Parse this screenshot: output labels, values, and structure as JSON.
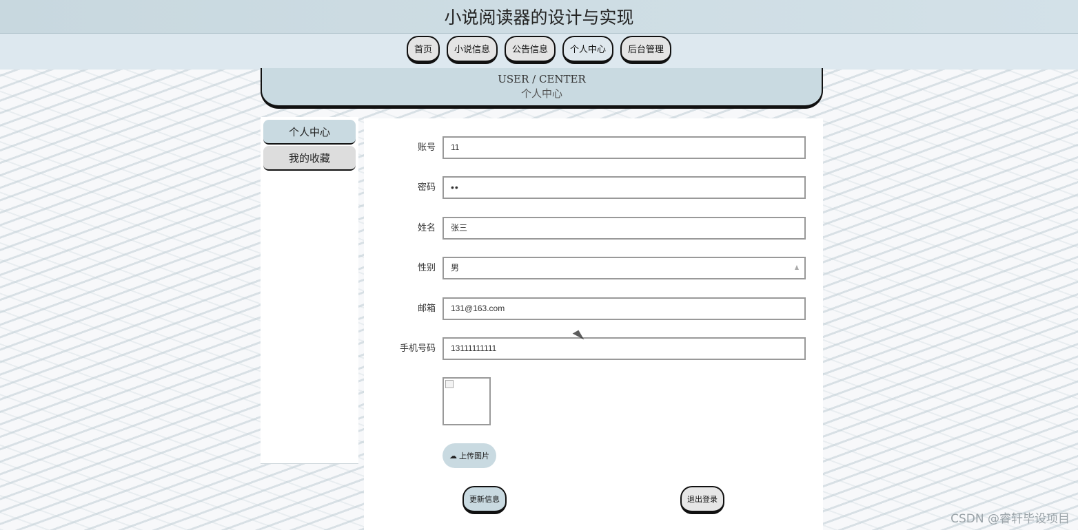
{
  "app": {
    "title": "小说阅读器的设计与实现"
  },
  "nav": {
    "items": [
      {
        "label": "首页"
      },
      {
        "label": "小说信息"
      },
      {
        "label": "公告信息"
      },
      {
        "label": "个人中心"
      },
      {
        "label": "后台管理"
      }
    ],
    "active": "个人中心"
  },
  "section": {
    "title_en": "USER / CENTER",
    "title_cn": "个人中心"
  },
  "sidebar": {
    "items": [
      {
        "label": "个人中心"
      },
      {
        "label": "我的收藏"
      }
    ]
  },
  "form": {
    "account": {
      "label": "账号",
      "value": "11"
    },
    "password": {
      "label": "密码",
      "value": "••"
    },
    "name": {
      "label": "姓名",
      "value": "张三"
    },
    "gender": {
      "label": "性别",
      "value": "男"
    },
    "email": {
      "label": "邮箱",
      "value": "131@163.com"
    },
    "phone": {
      "label": "手机号码",
      "value": "13111111111"
    },
    "upload_label": "上传图片",
    "update_label": "更新信息",
    "logout_label": "退出登录"
  },
  "icons": {
    "upload": "cloud-upload-icon",
    "avatar": "broken-image-icon"
  },
  "watermark": "CSDN @睿轩毕设项目",
  "colors": {
    "accent": "#c9dae1",
    "header_bg": "#ccdce3",
    "nav_bg": "#dde8ef"
  }
}
